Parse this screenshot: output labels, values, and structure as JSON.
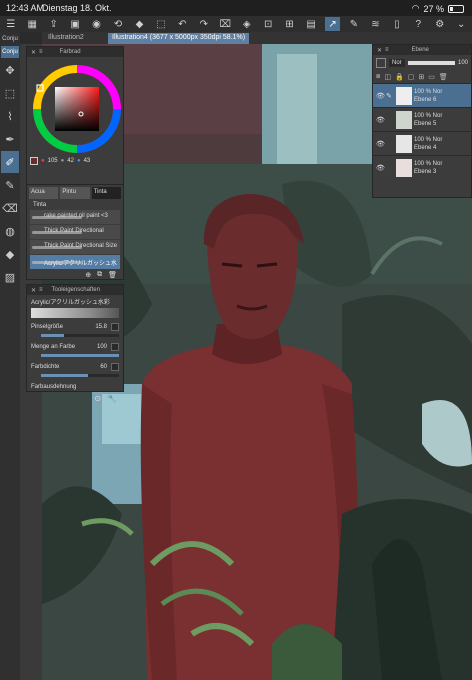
{
  "status_bar": {
    "time": "12:43 AM",
    "date": "Dienstag 18. Okt.",
    "battery_label": "27 %",
    "battery_level": 0.27
  },
  "document_tabs": [
    {
      "label": "Illustration2"
    },
    {
      "label": "Illustration4 (3677 x 5000px 350dpi 58.1%)"
    }
  ],
  "left_panel": {
    "tab_label": "Conju",
    "selected_label": "Conju"
  },
  "color_wheel_panel": {
    "title": "Farbrad",
    "hue": 105,
    "saturation": 42,
    "value": 43
  },
  "brush_panel": {
    "tabs": [
      "Acua",
      "Pintu",
      "Tinta"
    ],
    "subtab": "Tinta",
    "brushes": [
      "rake painted oil paint <3",
      "Thick Paint Directional",
      "Thick Paint Directional Size",
      "Acrylic/アクリルガッシュ水"
    ]
  },
  "tool_properties_panel": {
    "title": "Tooleigenschaften",
    "brush_name": "Acrylic/アクリルガッシュ水彩",
    "properties": [
      {
        "label": "Pinselgröße",
        "value": "15.8"
      },
      {
        "label": "Menge an Farbe",
        "value": "100"
      },
      {
        "label": "Farbdichte",
        "value": "60"
      },
      {
        "label": "Farbausdehnung",
        "value": ""
      }
    ]
  },
  "layer_panel": {
    "title": "Ebene",
    "blend_mode": "Nor",
    "opacity": "100",
    "layers": [
      {
        "opacity_mode": "100 % Nor",
        "name": "Ebene 6",
        "selected": true
      },
      {
        "opacity_mode": "100 % Nor",
        "name": "Ebene 5",
        "selected": false
      },
      {
        "opacity_mode": "100 % Nor",
        "name": "Ebene 4",
        "selected": false
      },
      {
        "opacity_mode": "100 % Nor",
        "name": "Ebene 3",
        "selected": false
      }
    ]
  },
  "colors": {
    "accent": "#4b6f91",
    "panel": "#3c3c3c",
    "shirt": "#7a2f30",
    "foliage": "#2f3a34"
  }
}
